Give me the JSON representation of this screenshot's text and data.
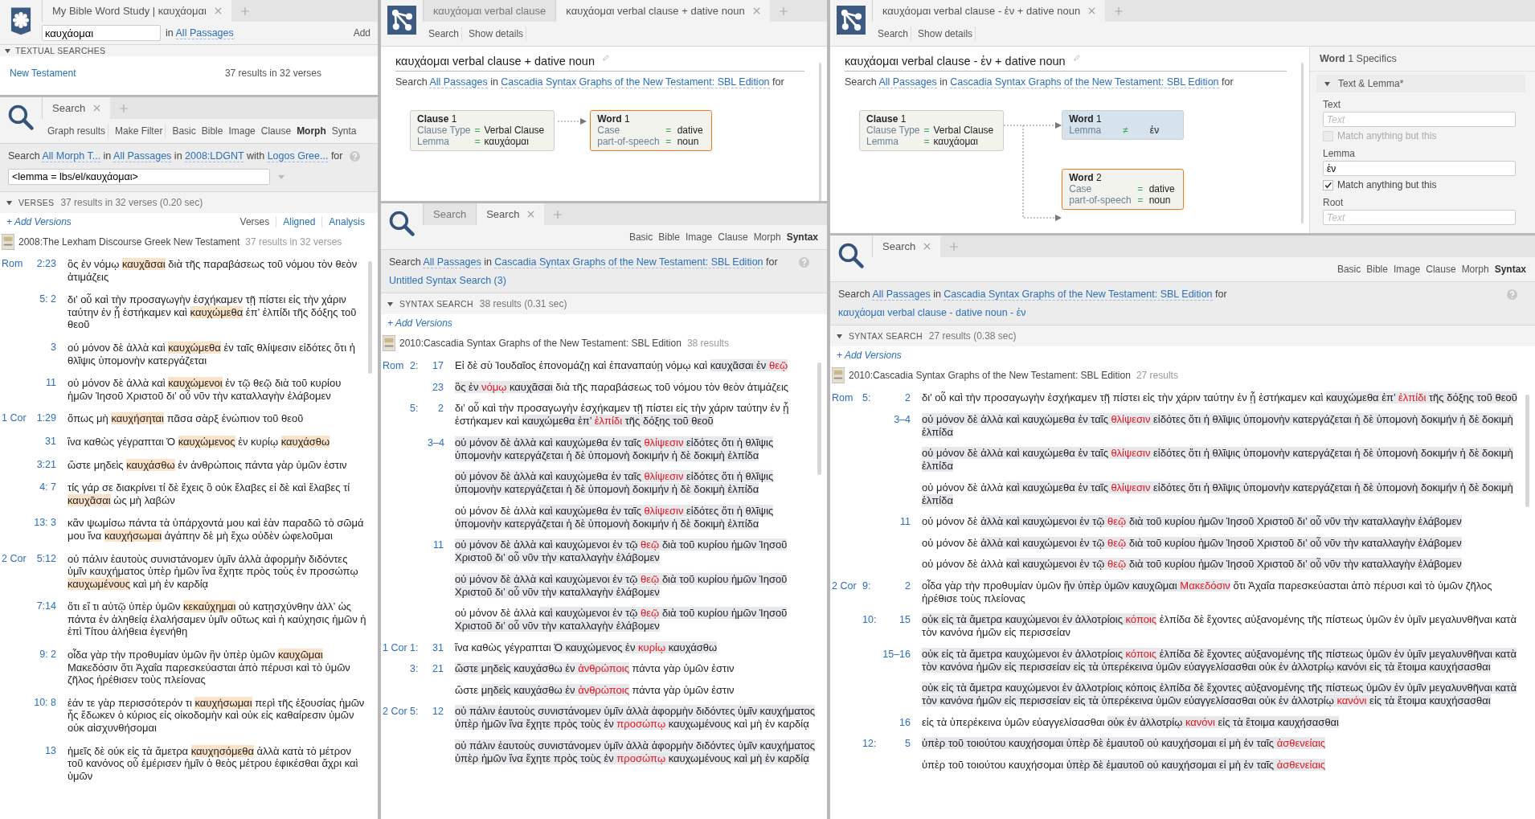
{
  "word_study": {
    "tabs": [
      {
        "label": "My Bible Word Study | καυχάομαι",
        "selected": true
      }
    ],
    "query": "καυχάομαι",
    "range": [
      {
        "text": "in ",
        "kind": "text"
      },
      {
        "text": "All Passages",
        "kind": "link"
      }
    ],
    "add_button": "Add",
    "section": {
      "title": "TEXTUAL SEARCHES",
      "expanded": true
    },
    "rows": [
      {
        "label": "New Testament",
        "count": "37 results in 32 verses"
      }
    ]
  },
  "morph_search": {
    "tabs": [
      {
        "label": "Search",
        "selected": true
      }
    ],
    "actions": [
      "Graph results",
      "Make Filter"
    ],
    "types": [
      {
        "label": "Basic",
        "selected": false
      },
      {
        "label": "Bible",
        "selected": false
      },
      {
        "label": "Image",
        "selected": false
      },
      {
        "label": "Clause",
        "selected": false
      },
      {
        "label": "Morph",
        "selected": true
      },
      {
        "label": "Synta",
        "selected": false
      }
    ],
    "sentence": [
      {
        "text": "Search ",
        "kind": "text"
      },
      {
        "text": "All Morph T...",
        "kind": "link"
      },
      {
        "text": " in ",
        "kind": "text"
      },
      {
        "text": "All Passages",
        "kind": "link"
      },
      {
        "text": " in ",
        "kind": "text"
      },
      {
        "text": "2008:LDGNT",
        "kind": "link"
      },
      {
        "text": " with ",
        "kind": "text"
      },
      {
        "text": "Logos Gree...",
        "kind": "link"
      },
      {
        "text": " for",
        "kind": "text"
      }
    ],
    "query": "<lemma = lbs/el/καυχάομαι>",
    "results_header": {
      "title": "VERSES",
      "summary": "37 results in 32 verses (0.20 sec)",
      "expanded": true
    },
    "add_versions": "+ Add Versions",
    "views": [
      {
        "label": "Verses",
        "selected": true
      },
      {
        "label": "Aligned",
        "selected": false
      },
      {
        "label": "Analysis",
        "selected": false
      }
    ],
    "resource": {
      "title": "2008:The Lexham Discourse Greek New Testament",
      "count": "37 results in 32 verses"
    },
    "verses": [
      {
        "book": "Rom",
        "ref": "2:23",
        "segments": [
          {
            "text": "ὃς ἐν νόμῳ ",
            "kind": "plain"
          },
          {
            "text": "καυχᾶσαι",
            "kind": "match"
          },
          {
            "text": " διὰ τῆς παραβάσεως τοῦ νόμου τὸν θεὸν ἀτιμάζεις",
            "kind": "plain"
          }
        ]
      },
      {
        "ref": "5: 2",
        "segments": [
          {
            "text": "δι’ οὗ καὶ τὴν προσαγωγὴν ἐσχήκαμεν τῇ πίστει εἰς τὴν χάριν ταύτην ἐν ᾗ ἑστήκαμεν καὶ ",
            "kind": "plain"
          },
          {
            "text": "καυχώμεθα",
            "kind": "match"
          },
          {
            "text": " ἐπ’ ἐλπίδι τῆς δόξης τοῦ θεοῦ",
            "kind": "plain"
          }
        ]
      },
      {
        "ref": "3",
        "segments": [
          {
            "text": "οὐ μόνον δὲ ἀλλὰ καὶ ",
            "kind": "plain"
          },
          {
            "text": "καυχώμεθα",
            "kind": "match"
          },
          {
            "text": " ἐν ταῖς θλίψεσιν εἰδότες ὅτι ἡ θλῖψις ὑπομονὴν κατεργάζεται",
            "kind": "plain"
          }
        ]
      },
      {
        "ref": "11",
        "segments": [
          {
            "text": "οὐ μόνον δὲ ἀλλὰ καὶ ",
            "kind": "plain"
          },
          {
            "text": "καυχώμενοι",
            "kind": "match"
          },
          {
            "text": " ἐν τῷ θεῷ διὰ τοῦ κυρίου ἡμῶν Ἰησοῦ Χριστοῦ δι’ οὗ νῦν τὴν καταλλαγὴν ἐλάβομεν",
            "kind": "plain"
          }
        ]
      },
      {
        "book": "1 Cor",
        "ref": "1:29",
        "segments": [
          {
            "text": "ὅπως μὴ ",
            "kind": "plain"
          },
          {
            "text": "καυχήσηται",
            "kind": "match"
          },
          {
            "text": " πᾶσα σὰρξ ἐνώπιον τοῦ θεοῦ",
            "kind": "plain"
          }
        ]
      },
      {
        "ref": "31",
        "segments": [
          {
            "text": "ἵνα καθὼς γέγραπται Ὁ ",
            "kind": "plain"
          },
          {
            "text": "καυχώμενος",
            "kind": "match"
          },
          {
            "text": " ἐν κυρίῳ ",
            "kind": "plain"
          },
          {
            "text": "καυχάσθω",
            "kind": "match"
          }
        ]
      },
      {
        "ref": "3:21",
        "segments": [
          {
            "text": "ὥστε μηδεὶς ",
            "kind": "plain"
          },
          {
            "text": "καυχάσθω",
            "kind": "match"
          },
          {
            "text": " ἐν ἀνθρώποις πάντα γὰρ ὑμῶν ἐστιν",
            "kind": "plain"
          }
        ]
      },
      {
        "ref": "4: 7",
        "segments": [
          {
            "text": "τίς γάρ σε διακρίνει τί δὲ ἔχεις ὃ οὐκ ἔλαβες εἰ δὲ καὶ ἔλαβες τί ",
            "kind": "plain"
          },
          {
            "text": "καυχᾶσαι",
            "kind": "match"
          },
          {
            "text": " ὡς μὴ λαβών",
            "kind": "plain"
          }
        ]
      },
      {
        "ref": "13: 3",
        "segments": [
          {
            "text": "κἂν ψωμίσω πάντα τὰ ὑπάρχοντά μου καὶ ἐὰν παραδῶ τὸ σῶμά μου ἵνα ",
            "kind": "plain"
          },
          {
            "text": "καυχήσωμαι",
            "kind": "match"
          },
          {
            "text": " ἀγάπην δὲ μὴ ἔχω οὐδὲν ὠφελοῦμαι",
            "kind": "plain"
          }
        ]
      },
      {
        "book": "2 Cor",
        "ref": "5:12",
        "segments": [
          {
            "text": "οὐ πάλιν ἑαυτοὺς συνιστάνομεν ὑμῖν ἀλλὰ ἀφορμὴν διδόντες ὑμῖν καυχήματος ὑπὲρ ἡμῶν ἵνα ἔχητε πρὸς τοὺς ἐν προσώπῳ ",
            "kind": "plain"
          },
          {
            "text": "καυχωμένους",
            "kind": "match"
          },
          {
            "text": " καὶ μὴ ἐν καρδίᾳ",
            "kind": "plain"
          }
        ]
      },
      {
        "ref": "7:14",
        "segments": [
          {
            "text": "ὅτι εἴ τι αὐτῷ ὑπὲρ ὑμῶν ",
            "kind": "plain"
          },
          {
            "text": "κεκαύχημαι",
            "kind": "match"
          },
          {
            "text": " οὐ κατῃσχύνθην ἀλλ’ ὡς πάντα ἐν ἀληθείᾳ ἐλαλήσαμεν ὑμῖν οὕτως καὶ ἡ καύχησις ἡμῶν ἡ ἐπὶ Τίτου ἀλήθεια ἐγενήθη",
            "kind": "plain"
          }
        ]
      },
      {
        "ref": "9: 2",
        "segments": [
          {
            "text": "οἶδα γὰρ τὴν προθυμίαν ὑμῶν ἣν ὑπὲρ ὑμῶν ",
            "kind": "plain"
          },
          {
            "text": "καυχῶμαι",
            "kind": "match"
          },
          {
            "text": " Μακεδόσιν ὅτι Ἀχαΐα παρεσκεύασται ἀπὸ πέρυσι καὶ τὸ ὑμῶν ζῆλος ἠρέθισεν τοὺς πλείονας",
            "kind": "plain"
          }
        ]
      },
      {
        "ref": "10: 8",
        "segments": [
          {
            "text": "ἐάν τε γὰρ περισσότερόν τι ",
            "kind": "plain"
          },
          {
            "text": "καυχήσωμαι",
            "kind": "match"
          },
          {
            "text": " περὶ τῆς ἐξουσίας ἡμῶν ἧς ἔδωκεν ὁ κύριος εἰς οἰκοδομὴν καὶ οὐκ εἰς καθαίρεσιν ὑμῶν οὐκ αἰσχυνθήσομαι",
            "kind": "plain"
          }
        ]
      },
      {
        "ref": "13",
        "segments": [
          {
            "text": "ἡμεῖς δὲ οὐκ εἰς τὰ ἄμετρα ",
            "kind": "plain"
          },
          {
            "text": "καυχησόμεθα",
            "kind": "match"
          },
          {
            "text": " ἀλλὰ κατὰ τὸ μέτρον τοῦ κανόνος οὗ ἐμέρισεν ἡμῖν ὁ θεὸς μέτρου ἐφικέσθαι ἄχρι καὶ ὑμῶν",
            "kind": "plain"
          }
        ]
      }
    ]
  },
  "syntax_editor_1": {
    "tabs": [
      {
        "label": "καυχάομαι verbal clause",
        "selected": false
      },
      {
        "label": "καυχάομαι verbal clause + dative noun",
        "selected": true
      }
    ],
    "actions": [
      "Search",
      "Show details"
    ],
    "title": "καυχάομαι verbal clause + dative noun",
    "sentence": [
      {
        "text": "Search ",
        "kind": "text"
      },
      {
        "text": "All Passages",
        "kind": "link"
      },
      {
        "text": " in ",
        "kind": "text"
      },
      {
        "text": "Cascadia Syntax Graphs of the New Testament: SBL Edition",
        "kind": "link"
      },
      {
        "text": " for",
        "kind": "text"
      }
    ],
    "nodes": [
      {
        "kind": "clause",
        "title": "**Clause** 1",
        "selected": false,
        "highlighted": false,
        "fields": [
          {
            "name": "Clause Type",
            "op": "=",
            "value": "Verbal Clause"
          },
          {
            "name": "Lemma",
            "op": "=",
            "value": "καυχάομαι"
          }
        ]
      },
      {
        "kind": "word",
        "title": "**Word** 1",
        "selected": true,
        "highlighted": false,
        "fields": [
          {
            "name": "Case",
            "op": "=",
            "value": "dative"
          },
          {
            "name": "part-of-speech",
            "op": "=",
            "value": "noun"
          }
        ]
      }
    ]
  },
  "syntax_search_1": {
    "tabs": [
      {
        "label": "Search",
        "selected": false
      },
      {
        "label": "Search",
        "selected": true
      }
    ],
    "types": [
      {
        "label": "Basic",
        "selected": false
      },
      {
        "label": "Bible",
        "selected": false
      },
      {
        "label": "Image",
        "selected": false
      },
      {
        "label": "Clause",
        "selected": false
      },
      {
        "label": "Morph",
        "selected": false
      },
      {
        "label": "Syntax",
        "selected": true
      }
    ],
    "sentence": [
      {
        "text": "Search ",
        "kind": "text"
      },
      {
        "text": "All Passages",
        "kind": "link"
      },
      {
        "text": " in ",
        "kind": "text"
      },
      {
        "text": "Cascadia Syntax Graphs of the New Testament: SBL Edition",
        "kind": "link"
      },
      {
        "text": " for",
        "kind": "text"
      }
    ],
    "query_link": "Untitled Syntax Search (3)",
    "results_header": {
      "title": "SYNTAX SEARCH",
      "summary": "38 results (0.31 sec)",
      "expanded": true
    },
    "add_versions": "+ Add Versions",
    "resource": {
      "title": "2010:Cascadia Syntax Graphs of the New Testament: SBL Edition",
      "count": "38 results"
    },
    "verses": [
      {
        "book": "Rom",
        "chapter": "2:",
        "verse": "17",
        "segments": [
          {
            "text": "Εἰ δὲ σὺ Ἰουδαῖος ἐπονομάζῃ καὶ ἐπαναπαύῃ νόμῳ καὶ ",
            "kind": "plain"
          },
          {
            "text": "καυχᾶσαι ἐν ",
            "kind": "hit"
          },
          {
            "text": "θεῷ",
            "kind": "focus"
          }
        ]
      },
      {
        "verse": "23",
        "segments": [
          {
            "text": "ὃς ἐν ",
            "kind": "hit"
          },
          {
            "text": "νόμῳ",
            "kind": "focus"
          },
          {
            "text": " καυχᾶσαι",
            "kind": "hit"
          },
          {
            "text": " διὰ τῆς παραβάσεως τοῦ νόμου τὸν θεὸν ἀτιμάζεις",
            "kind": "plain"
          }
        ]
      },
      {
        "chapter": "5:",
        "verse": "2",
        "segments": [
          {
            "text": "δι’ οὗ καὶ τὴν προσαγωγὴν ἐσχήκαμεν τῇ πίστει εἰς τὴν χάριν ταύτην ἐν ᾗ ἑστήκαμεν καὶ ",
            "kind": "plain"
          },
          {
            "text": "καυχώμεθα ἐπ’ ",
            "kind": "hit"
          },
          {
            "text": "ἐλπίδι",
            "kind": "focus"
          },
          {
            "text": " τῆς δόξης τοῦ θεοῦ",
            "kind": "hit"
          }
        ]
      },
      {
        "verse": "3–4",
        "segments": [
          {
            "text": "οὐ μόνον δὲ ἀλλὰ καὶ καυχώμεθα ἐν ταῖς ",
            "kind": "hit"
          },
          {
            "text": "θλίψεσιν",
            "kind": "focus"
          },
          {
            "text": " εἰδότες ὅτι ἡ θλῖψις ὑπομονὴν κατεργάζεται ἡ δὲ ὑπομονὴ δοκιμήν ἡ δὲ δοκιμὴ ἐλπίδα",
            "kind": "hit"
          }
        ]
      },
      {
        "segments": [
          {
            "text": "οὐ μόνον δὲ ἀλλὰ καὶ καυχώμεθα ἐν ταῖς ",
            "kind": "hit"
          },
          {
            "text": "θλίψεσιν",
            "kind": "focus"
          },
          {
            "text": " εἰδότες ὅτι ἡ θλῖψις ὑπομονὴν κατεργάζεται ἡ δὲ ὑπομονὴ δοκιμήν ἡ δὲ δοκιμὴ ἐλπίδα",
            "kind": "hit"
          }
        ]
      },
      {
        "segments": [
          {
            "text": "οὐ μόνον δὲ ἀλλὰ ",
            "kind": "plain"
          },
          {
            "text": "καὶ καυχώμεθα ἐν ταῖς ",
            "kind": "hit"
          },
          {
            "text": "θλίψεσιν",
            "kind": "focus"
          },
          {
            "text": " εἰδότες ὅτι ἡ θλῖψις ὑπομονὴν κατεργάζεται ἡ δὲ ὑπομονὴ δοκιμήν ἡ δὲ δοκιμὴ ἐλπίδα",
            "kind": "hit"
          }
        ]
      },
      {
        "verse": "11",
        "segments": [
          {
            "text": "οὐ μόνον δὲ ἀλλὰ καὶ καυχώμενοι ἐν τῷ ",
            "kind": "hit"
          },
          {
            "text": "θεῷ",
            "kind": "focus"
          },
          {
            "text": " διὰ τοῦ κυρίου ἡμῶν Ἰησοῦ Χριστοῦ δι’ οὗ νῦν τὴν καταλλαγὴν ἐλάβομεν",
            "kind": "hit"
          }
        ]
      },
      {
        "segments": [
          {
            "text": "οὐ μόνον δὲ ἀλλὰ καὶ καυχώμενοι ἐν τῷ ",
            "kind": "hit"
          },
          {
            "text": "θεῷ",
            "kind": "focus"
          },
          {
            "text": " διὰ τοῦ κυρίου ἡμῶν Ἰησοῦ Χριστοῦ δι’ οὗ νῦν τὴν καταλλαγὴν ἐλάβομεν",
            "kind": "hit"
          }
        ]
      },
      {
        "segments": [
          {
            "text": "οὐ μόνον δὲ ἀλλὰ ",
            "kind": "plain"
          },
          {
            "text": "καὶ καυχώμενοι ἐν τῷ ",
            "kind": "hit"
          },
          {
            "text": "θεῷ",
            "kind": "focus"
          },
          {
            "text": " διὰ τοῦ κυρίου ἡμῶν Ἰησοῦ Χριστοῦ δι’ οὗ νῦν τὴν καταλλαγὴν ἐλάβομεν",
            "kind": "hit"
          }
        ]
      },
      {
        "book": "1 Cor",
        "chapter": "1:",
        "verse": "31",
        "segments": [
          {
            "text": "ἵνα καθὼς γέγραπται ",
            "kind": "plain"
          },
          {
            "text": "Ὁ καυχώμενος ἐν ",
            "kind": "hit"
          },
          {
            "text": "κυρίῳ",
            "kind": "focus"
          },
          {
            "text": " καυχάσθω",
            "kind": "hit"
          }
        ]
      },
      {
        "chapter": "3:",
        "verse": "21",
        "segments": [
          {
            "text": "ὥστε μηδεὶς καυχάσθω ἐν ",
            "kind": "hit"
          },
          {
            "text": "ἀνθρώποις",
            "kind": "focus"
          },
          {
            "text": " πάντα γὰρ ὑμῶν ἐστιν",
            "kind": "plain"
          }
        ]
      },
      {
        "segments": [
          {
            "text": "ὥστε ",
            "kind": "plain"
          },
          {
            "text": "μηδεὶς καυχάσθω ἐν ",
            "kind": "hit"
          },
          {
            "text": "ἀνθρώποις",
            "kind": "focus"
          },
          {
            "text": " πάντα γὰρ ὑμῶν ἐστιν",
            "kind": "plain"
          }
        ]
      },
      {
        "book": "2 Cor",
        "chapter": "5:",
        "verse": "12",
        "segments": [
          {
            "text": "οὐ πάλιν ἑαυτοὺς συνιστάνομεν ὑμῖν ἀλλὰ ἀφορμὴν διδόντες ὑμῖν καυχήματος ὑπὲρ ἡμῶν ἵνα ἔχητε πρὸς τοὺς ἐν ",
            "kind": "hit"
          },
          {
            "text": "προσώπῳ",
            "kind": "focus"
          },
          {
            "text": " καυχωμένους",
            "kind": "hit"
          },
          {
            "text": " καὶ μὴ ἐν καρδίᾳ",
            "kind": "plain"
          }
        ]
      },
      {
        "segments": [
          {
            "text": "οὐ πάλιν ἑαυτοὺς συνιστάνομεν ὑμῖν ἀλλὰ ἀφορμὴν διδόντες ὑμῖν καυχήματος ὑπὲρ ἡμῶν ἵνα ἔχητε πρὸς τοὺς ἐν ",
            "kind": "hit"
          },
          {
            "text": "προσώπῳ",
            "kind": "focus"
          },
          {
            "text": " καυχωμένους καὶ μὴ ἐν καρδίᾳ",
            "kind": "hit"
          }
        ]
      }
    ]
  },
  "syntax_editor_2": {
    "tabs": [
      {
        "label": "καυχάομαι verbal clause - ἐν + dative noun",
        "selected": true
      }
    ],
    "actions": [
      "Search",
      "Show details"
    ],
    "title": "καυχάομαι verbal clause - ἐν + dative noun",
    "sentence": [
      {
        "text": "Search ",
        "kind": "text"
      },
      {
        "text": "All Passages",
        "kind": "link"
      },
      {
        "text": " in ",
        "kind": "text"
      },
      {
        "text": "Cascadia Syntax Graphs of the New Testament: SBL Edition",
        "kind": "link"
      },
      {
        "text": " for",
        "kind": "text"
      }
    ],
    "nodes": [
      {
        "kind": "clause",
        "title": "**Clause** 1",
        "selected": false,
        "highlighted": false,
        "fields": [
          {
            "name": "Clause Type",
            "op": "=",
            "value": "Verbal Clause"
          },
          {
            "name": "Lemma",
            "op": "=",
            "value": "καυχάομαι"
          }
        ]
      },
      {
        "kind": "word",
        "title": "**Word** 1",
        "selected": false,
        "highlighted": true,
        "fields": [
          {
            "name": "Lemma",
            "op": "≠",
            "value": "ἐν"
          }
        ]
      },
      {
        "kind": "word",
        "title": "**Word** 2",
        "selected": true,
        "highlighted": false,
        "fields": [
          {
            "name": "Case",
            "op": "=",
            "value": "dative"
          },
          {
            "name": "part-of-speech",
            "op": "=",
            "value": "noun"
          }
        ]
      }
    ],
    "specifics": {
      "title": "**Word** 1 Specifics",
      "section": {
        "title": "Text & Lemma*",
        "expanded": true
      },
      "fields": [
        {
          "label": "Text",
          "placeholder": "Text",
          "option": {
            "label": "Match anything but this",
            "checked": false,
            "disabled": true
          }
        },
        {
          "label": "Lemma",
          "value": "ἐν",
          "option": {
            "label": "Match anything but this",
            "checked": true,
            "disabled": false
          }
        },
        {
          "label": "Root",
          "placeholder": "Text"
        }
      ]
    }
  },
  "syntax_search_2": {
    "tabs": [
      {
        "label": "Search",
        "selected": true
      }
    ],
    "types": [
      {
        "label": "Basic",
        "selected": false
      },
      {
        "label": "Bible",
        "selected": false
      },
      {
        "label": "Image",
        "selected": false
      },
      {
        "label": "Clause",
        "selected": false
      },
      {
        "label": "Morph",
        "selected": false
      },
      {
        "label": "Syntax",
        "selected": true
      }
    ],
    "sentence": [
      {
        "text": "Search ",
        "kind": "text"
      },
      {
        "text": "All Passages",
        "kind": "link"
      },
      {
        "text": " in ",
        "kind": "text"
      },
      {
        "text": "Cascadia Syntax Graphs of the New Testament: SBL Edition",
        "kind": "link"
      },
      {
        "text": " for",
        "kind": "text"
      }
    ],
    "query_link": "καυχάομαι verbal clause - dative noun - ἐν",
    "results_header": {
      "title": "SYNTAX SEARCH",
      "summary": "27 results (0.38 sec)",
      "expanded": true
    },
    "add_versions": "+ Add Versions",
    "resource": {
      "title": "2010:Cascadia Syntax Graphs of the New Testament: SBL Edition",
      "count": "27 results"
    },
    "verses": [
      {
        "book": "Rom",
        "chapter": "5:",
        "verse": "2",
        "segments": [
          {
            "text": "δι’ οὗ καὶ τὴν προσαγωγὴν ἐσχήκαμεν τῇ πίστει εἰς τὴν χάριν ταύτην ἐν ᾗ ἑστήκαμεν καὶ ",
            "kind": "plain"
          },
          {
            "text": "καυχώμεθα ἐπ’ ",
            "kind": "hit"
          },
          {
            "text": "ἐλπίδι",
            "kind": "focus"
          },
          {
            "text": " τῆς δόξης τοῦ θεοῦ",
            "kind": "hit"
          }
        ]
      },
      {
        "verse": "3–4",
        "segments": [
          {
            "text": "οὐ μόνον δὲ ἀλλὰ καὶ καυχώμεθα ἐν ταῖς ",
            "kind": "hit"
          },
          {
            "text": "θλίψεσιν",
            "kind": "focus"
          },
          {
            "text": " εἰδότες ὅτι ἡ θλῖψις ὑπομονὴν κατεργάζεται ἡ δὲ ὑπομονὴ δοκιμήν ἡ δὲ δοκιμὴ ἐλπίδα",
            "kind": "hit"
          }
        ]
      },
      {
        "segments": [
          {
            "text": "οὐ μόνον δὲ ἀλλὰ καὶ καυχώμεθα ἐν ταῖς ",
            "kind": "hit"
          },
          {
            "text": "θλίψεσιν",
            "kind": "focus"
          },
          {
            "text": " εἰδότες ὅτι ἡ θλῖψις ὑπομονὴν κατεργάζεται ἡ δὲ ὑπομονὴ δοκιμήν ἡ δὲ δοκιμὴ ἐλπίδα",
            "kind": "hit"
          }
        ]
      },
      {
        "segments": [
          {
            "text": "οὐ μόνον δὲ ἀλλὰ ",
            "kind": "plain"
          },
          {
            "text": "καὶ καυχώμεθα ἐν ταῖς ",
            "kind": "hit"
          },
          {
            "text": "θλίψεσιν",
            "kind": "focus"
          },
          {
            "text": " εἰδότες ὅτι ἡ θλῖψις ὑπομονὴν κατεργάζεται ἡ δὲ ὑπομονὴ δοκιμήν ἡ δὲ δοκιμὴ ἐλπίδα",
            "kind": "hit"
          }
        ]
      },
      {
        "verse": "11",
        "segments": [
          {
            "text": "οὐ μόνον δὲ ",
            "kind": "plain"
          },
          {
            "text": "ἀλλὰ καὶ καυχώμενοι ἐν τῷ ",
            "kind": "hit"
          },
          {
            "text": "θεῷ",
            "kind": "focus"
          },
          {
            "text": " διὰ τοῦ κυρίου ἡμῶν Ἰησοῦ Χριστοῦ δι’ οὗ νῦν τὴν καταλλαγὴν ἐλάβομεν",
            "kind": "hit"
          }
        ]
      },
      {
        "segments": [
          {
            "text": "οὐ μόνον δὲ ",
            "kind": "plain"
          },
          {
            "text": "ἀλλὰ καὶ καυχώμενοι ἐν τῷ ",
            "kind": "hit"
          },
          {
            "text": "θεῷ",
            "kind": "focus"
          },
          {
            "text": " διὰ τοῦ κυρίου ἡμῶν Ἰησοῦ Χριστοῦ δι’ οὗ νῦν τὴν καταλλαγὴν ἐλάβομεν",
            "kind": "hit"
          }
        ]
      },
      {
        "segments": [
          {
            "text": "οὐ μόνον δὲ ἀλλὰ ",
            "kind": "plain"
          },
          {
            "text": "καὶ καυχώμενοι ἐν τῷ ",
            "kind": "hit"
          },
          {
            "text": "θεῷ",
            "kind": "focus"
          },
          {
            "text": " διὰ τοῦ κυρίου ἡμῶν Ἰησοῦ Χριστοῦ δι’ οὗ νῦν τὴν καταλλαγὴν ἐλάβομεν",
            "kind": "hit"
          }
        ]
      },
      {
        "book": "2 Cor",
        "chapter": "9:",
        "verse": "2",
        "segments": [
          {
            "text": "οἶδα γὰρ τὴν προθυμίαν ὑμῶν ",
            "kind": "plain"
          },
          {
            "text": "ἣν ὑπὲρ ὑμῶν καυχῶμαι ",
            "kind": "hit"
          },
          {
            "text": "Μακεδόσιν",
            "kind": "focus"
          },
          {
            "text": " ὅτι Ἀχαΐα παρεσκεύασται ἀπὸ πέρυσι καὶ τὸ ὑμῶν ζῆλος ἠρέθισε τοὺς πλείονας",
            "kind": "plain"
          }
        ]
      },
      {
        "chapter": "10:",
        "verse": "15",
        "segments": [
          {
            "text": "οὐκ εἰς τὰ ἄμετρα καυχώμενοι ἐν ἀλλοτρίοις ",
            "kind": "hit"
          },
          {
            "text": "κόποις",
            "kind": "focus"
          },
          {
            "text": " ἐλπίδα δὲ ἔχοντες αὐξανομένης τῆς πίστεως ὑμῶν ἐν ὑμῖν μεγαλυνθῆναι κατὰ τὸν κανόνα ἡμῶν εἰς περισσείαν",
            "kind": "plain"
          }
        ]
      },
      {
        "verse": "15–16",
        "segments": [
          {
            "text": "οὐκ εἰς τὰ ἄμετρα καυχώμενοι ἐν ἀλλοτρίοις ",
            "kind": "hit"
          },
          {
            "text": "κόποις",
            "kind": "focus"
          },
          {
            "text": " ἐλπίδα δὲ ἔχοντες αὐξανομένης τῆς πίστεως ὑμῶν ἐν ὑμῖν μεγαλυνθῆναι κατὰ τὸν κανόνα ἡμῶν εἰς περισσείαν εἰς τὰ ὑπερέκεινα ὑμῶν εὐαγγελίσασθαι οὐκ ἐν ἀλλοτρίῳ κανόνι εἰς τὰ ἕτοιμα καυχήσασθαι",
            "kind": "hit"
          }
        ]
      },
      {
        "segments": [
          {
            "text": "οὐκ εἰς τὰ ἄμετρα καυχώμενοι ἐν ἀλλοτρίοις κόποις ἐλπίδα δὲ ἔχοντες αὐξανομένης τῆς πίστεως ὑμῶν ἐν ὑμῖν μεγαλυνθῆναι κατὰ τὸν κανόνα ἡμῶν εἰς περισσείαν εἰς τὰ ὑπερέκεινα ὑμῶν εὐαγγελίσασθαι οὐκ ἐν ἀλλοτρίῳ ",
            "kind": "hit"
          },
          {
            "text": "κανόνι",
            "kind": "focus"
          },
          {
            "text": " εἰς τὰ ἕτοιμα καυχήσασθαι",
            "kind": "hit"
          }
        ]
      },
      {
        "verse": "16",
        "segments": [
          {
            "text": "εἰς τὰ ὑπερέκεινα ὑμῶν εὐαγγελίσασθαι ",
            "kind": "plain"
          },
          {
            "text": "οὐκ ἐν ἀλλοτρίῳ ",
            "kind": "hit"
          },
          {
            "text": "κανόνι",
            "kind": "focus"
          },
          {
            "text": " εἰς τὰ ἕτοιμα καυχήσασθαι",
            "kind": "hit"
          }
        ]
      },
      {
        "chapter": "12:",
        "verse": "5",
        "segments": [
          {
            "text": "ὑπὲρ τοῦ τοιούτου καυχήσομαι ὑπὲρ δὲ ἐμαυτοῦ οὐ καυχήσομαι εἰ μὴ ἐν ταῖς ",
            "kind": "hit"
          },
          {
            "text": "ἀσθενείαις",
            "kind": "focus"
          }
        ]
      },
      {
        "segments": [
          {
            "text": "ὑπὲρ τοῦ τοιούτου καυχήσομαι ",
            "kind": "plain"
          },
          {
            "text": "ὑπὲρ δὲ ἐμαυτοῦ οὐ καυχήσομαι εἰ μὴ ἐν ταῖς ",
            "kind": "hit"
          },
          {
            "text": "ἀσθενείαις",
            "kind": "focus"
          }
        ]
      }
    ]
  }
}
